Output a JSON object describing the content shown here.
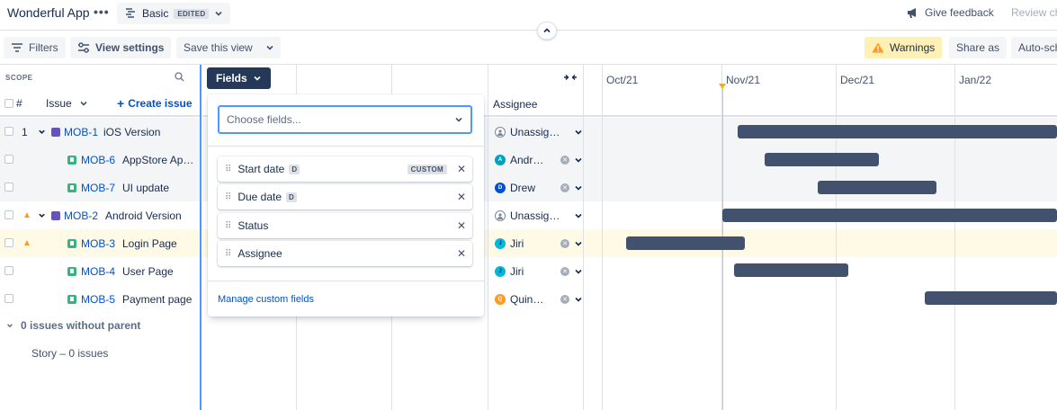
{
  "topbar": {
    "app_title": "Wonderful App",
    "plan_name": "Basic",
    "edited_badge": "EDITED",
    "give_feedback": "Give feedback",
    "review_changes": "Review ch"
  },
  "toolbar": {
    "filters": "Filters",
    "view_settings": "View settings",
    "save_view": "Save this view",
    "warnings": "Warnings",
    "share_as": "Share as",
    "auto_schedule": "Auto-sch"
  },
  "scope": {
    "label": "SCOPE",
    "col_hash": "#",
    "col_issue": "Issue",
    "create_issue": "Create issue"
  },
  "rows": [
    {
      "num": "1",
      "key": "MOB-1",
      "summary": "iOS Version",
      "type": "epic",
      "warning": false,
      "assignee": "Unassig…",
      "avatar": "",
      "avatar_color": "#ffffff"
    },
    {
      "num": "",
      "key": "MOB-6",
      "summary": "AppStore Ap…",
      "type": "story",
      "warning": false,
      "assignee": "Andr…",
      "avatar": "A",
      "avatar_color": "#00a3bf"
    },
    {
      "num": "",
      "key": "MOB-7",
      "summary": "UI update",
      "type": "story",
      "warning": false,
      "assignee": "Drew",
      "avatar": "D",
      "avatar_color": "#0052cc"
    },
    {
      "num": "",
      "key": "MOB-2",
      "summary": "Android Version",
      "type": "epic",
      "warning": true,
      "assignee": "Unassig…",
      "avatar": "",
      "avatar_color": "#ffffff"
    },
    {
      "num": "",
      "key": "MOB-3",
      "summary": "Login Page",
      "type": "story",
      "warning": true,
      "assignee": "Jiri",
      "avatar": "J",
      "avatar_color": "#00b8d9"
    },
    {
      "num": "",
      "key": "MOB-4",
      "summary": "User Page",
      "type": "story",
      "warning": false,
      "assignee": "Jiri",
      "avatar": "J",
      "avatar_color": "#00b8d9"
    },
    {
      "num": "",
      "key": "MOB-5",
      "summary": "Payment page",
      "type": "story",
      "warning": false,
      "assignee": "Quin…",
      "avatar": "Q",
      "avatar_color": "#ff991f"
    }
  ],
  "no_parent": {
    "label": "0 issues without parent",
    "story_count": "Story – 0 issues"
  },
  "columns": {
    "assignee_header": "Assignee"
  },
  "fields_panel": {
    "button_label": "Fields",
    "placeholder": "Choose fields...",
    "items": [
      {
        "label": "Start date",
        "badge": "D",
        "custom": "CUSTOM"
      },
      {
        "label": "Due date",
        "badge": "D",
        "custom": ""
      },
      {
        "label": "Status",
        "badge": "",
        "custom": ""
      },
      {
        "label": "Assignee",
        "badge": "",
        "custom": ""
      }
    ],
    "manage_link": "Manage custom fields"
  },
  "timeline": {
    "months": [
      "Oct/21",
      "Nov/21",
      "Dec/21",
      "Jan/22"
    ]
  },
  "colors": {
    "accent": "#0052cc",
    "bar": "#42526e",
    "today": "#ffab00",
    "warning_bg": "#fff0b3"
  }
}
